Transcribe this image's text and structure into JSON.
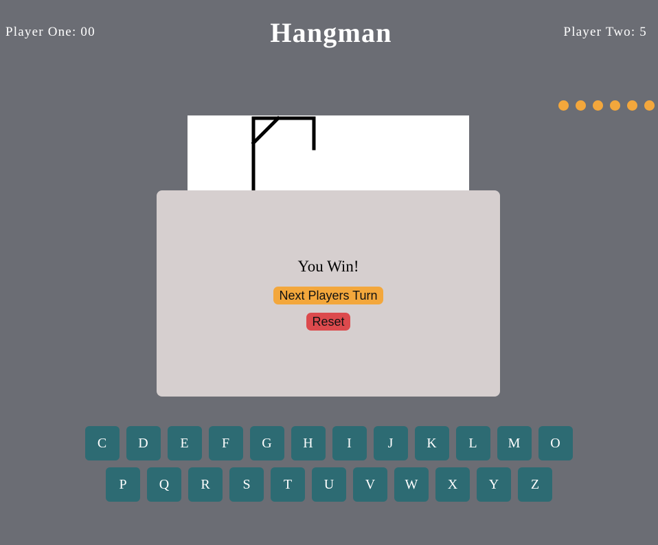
{
  "header": {
    "player_one_score": "Player One: 00",
    "title": "Hangman",
    "player_two_score": "Player Two: 5"
  },
  "lives_remaining": 6,
  "colors": {
    "background": "#6b6d74",
    "accent": "#f3a73c",
    "danger": "#dc4a4d",
    "key": "#2d6b73",
    "modal": "#d6cfcf"
  },
  "modal": {
    "message": "You Win!",
    "next_label": "Next Players Turn",
    "reset_label": "Reset"
  },
  "keyboard": {
    "row1": [
      "C",
      "D",
      "E",
      "F",
      "G",
      "H",
      "I",
      "J",
      "K",
      "L",
      "M",
      "O"
    ],
    "row2": [
      "P",
      "Q",
      "R",
      "S",
      "T",
      "U",
      "V",
      "W",
      "X",
      "Y",
      "Z"
    ]
  }
}
